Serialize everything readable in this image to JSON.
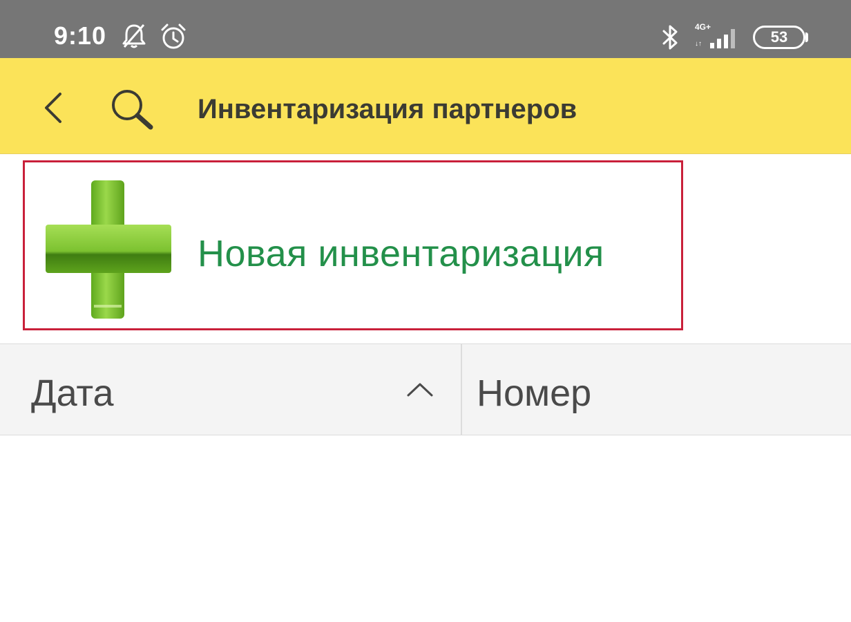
{
  "status_bar": {
    "time": "9:10",
    "icons": [
      "bell-muted-icon",
      "alarm-icon",
      "bluetooth-icon",
      "signal-icon",
      "battery-icon"
    ],
    "network": "4G+",
    "battery_level": "53"
  },
  "app_bar": {
    "title": "Инвентаризация партнеров",
    "back_icon": "chevron-left-icon",
    "search_icon": "search-icon",
    "background_color": "#fbe359"
  },
  "new_action": {
    "label": "Новая инвентаризация",
    "icon": "green-plus-icon",
    "label_color": "#23904a",
    "highlight_color": "#c9203a"
  },
  "table": {
    "columns": [
      {
        "label": "Дата",
        "sort": "ascending"
      },
      {
        "label": "Номер"
      }
    ],
    "rows": []
  }
}
